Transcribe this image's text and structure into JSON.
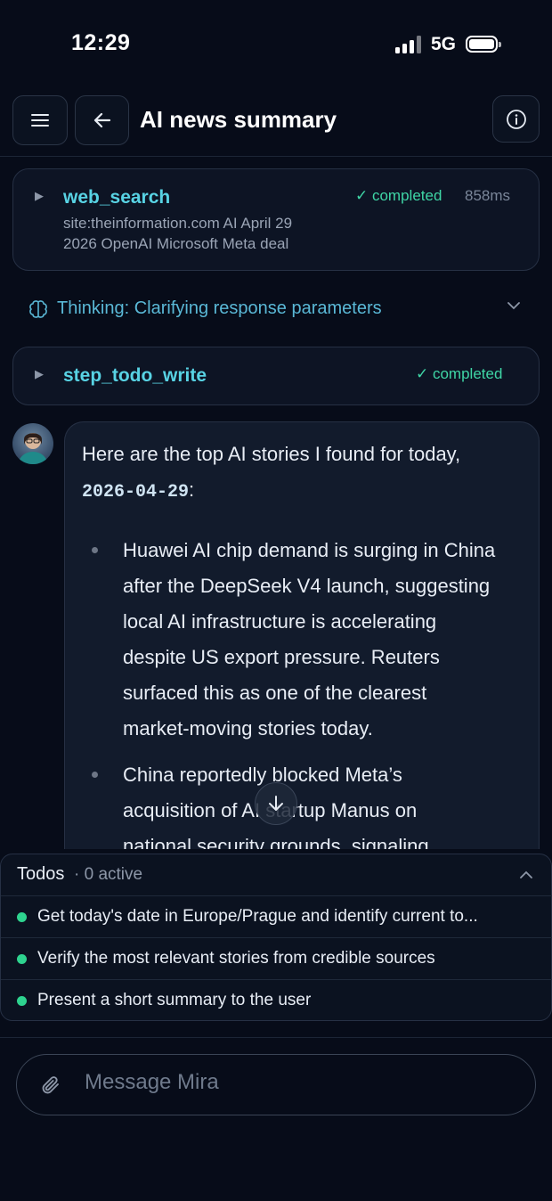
{
  "status_bar": {
    "time": "12:29",
    "network": "5G"
  },
  "header": {
    "title": "AI news summary",
    "menu_icon": "hamburger-icon",
    "back_icon": "arrow-left-icon",
    "info_icon": "info-icon"
  },
  "tool_calls": [
    {
      "name": "web_search",
      "status": "✓ completed",
      "duration": "858ms",
      "query_line1": "site:theinformation.com AI April 29",
      "query_line2": "2026 OpenAI Microsoft Meta deal"
    },
    {
      "name": "step_todo_write",
      "status": "✓ completed"
    }
  ],
  "thinking": {
    "label": "Thinking: Clarifying response parameters"
  },
  "message": {
    "intro": "Here are the top AI stories I found for today,",
    "date": "2026-04-29",
    "date_suffix": ":",
    "bullets": [
      {
        "lines": [
          "Huawei AI chip demand is surging in China",
          "after the DeepSeek V4 launch, suggesting",
          "local AI infrastructure is accelerating",
          "despite US export pressure. Reuters",
          "surfaced this as one of the clearest",
          "market-moving stories today."
        ]
      },
      {
        "lines": [
          "China reportedly blocked Meta’s",
          "acquisition of AI startup Manus on",
          "national security grounds, signaling"
        ]
      }
    ]
  },
  "todos": {
    "label": "Todos",
    "count": "· 0 active",
    "items": [
      "Get today's date in Europe/Prague and identify current to...",
      "Verify the most relevant stories from credible sources",
      "Present a short summary to the user"
    ],
    "status_color": "#2ed38f"
  },
  "composer": {
    "placeholder": "Message Mira",
    "attach_icon": "paperclip-icon"
  },
  "colors": {
    "background": "#070c19",
    "accent": "#58d3e4",
    "success": "#3fd6a6"
  }
}
